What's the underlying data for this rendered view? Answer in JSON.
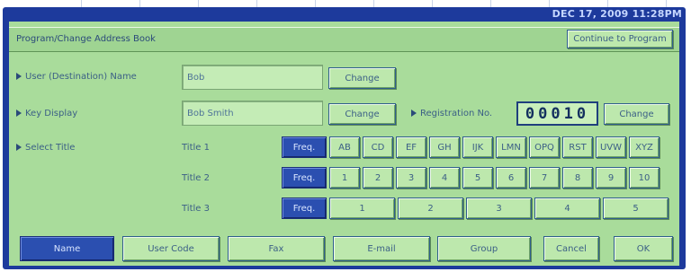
{
  "clock": "DEC 17, 2009 11:28PM",
  "window": {
    "title": "Program/Change Address Book",
    "continue_button": "Continue to Program"
  },
  "rows": {
    "user_name": {
      "label": "User (Destination) Name",
      "value": "Bob",
      "change_button": "Change"
    },
    "key_display": {
      "label": "Key Display",
      "value": "Bob Smith",
      "change_button": "Change"
    },
    "registration": {
      "label": "Registration No.",
      "value": "00010",
      "change_button": "Change"
    },
    "select_title": {
      "label": "Select Title"
    }
  },
  "titles": {
    "title1": {
      "label": "Title 1",
      "buttons": [
        "Freq.",
        "AB",
        "CD",
        "EF",
        "GH",
        "IJK",
        "LMN",
        "OPQ",
        "RST",
        "UVW",
        "XYZ"
      ],
      "selected": "Freq."
    },
    "title2": {
      "label": "Title 2",
      "buttons": [
        "Freq.",
        "1",
        "2",
        "3",
        "4",
        "5",
        "6",
        "7",
        "8",
        "9",
        "10"
      ],
      "selected": "Freq."
    },
    "title3": {
      "label": "Title 3",
      "buttons": [
        "Freq.",
        "1",
        "2",
        "3",
        "4",
        "5"
      ],
      "selected": "Freq."
    }
  },
  "bottom_tabs": [
    {
      "label": "Name",
      "selected": true
    },
    {
      "label": "User Code",
      "selected": false
    },
    {
      "label": "Fax",
      "selected": false
    },
    {
      "label": "E-mail",
      "selected": false
    },
    {
      "label": "Group",
      "selected": false
    }
  ],
  "footer": {
    "cancel": "Cancel",
    "ok": "OK"
  },
  "colors": {
    "screen": "#a9dc9b",
    "bezel": "#1d3a9c",
    "selected": "#2b4fb0",
    "text": "#3b5f86"
  }
}
